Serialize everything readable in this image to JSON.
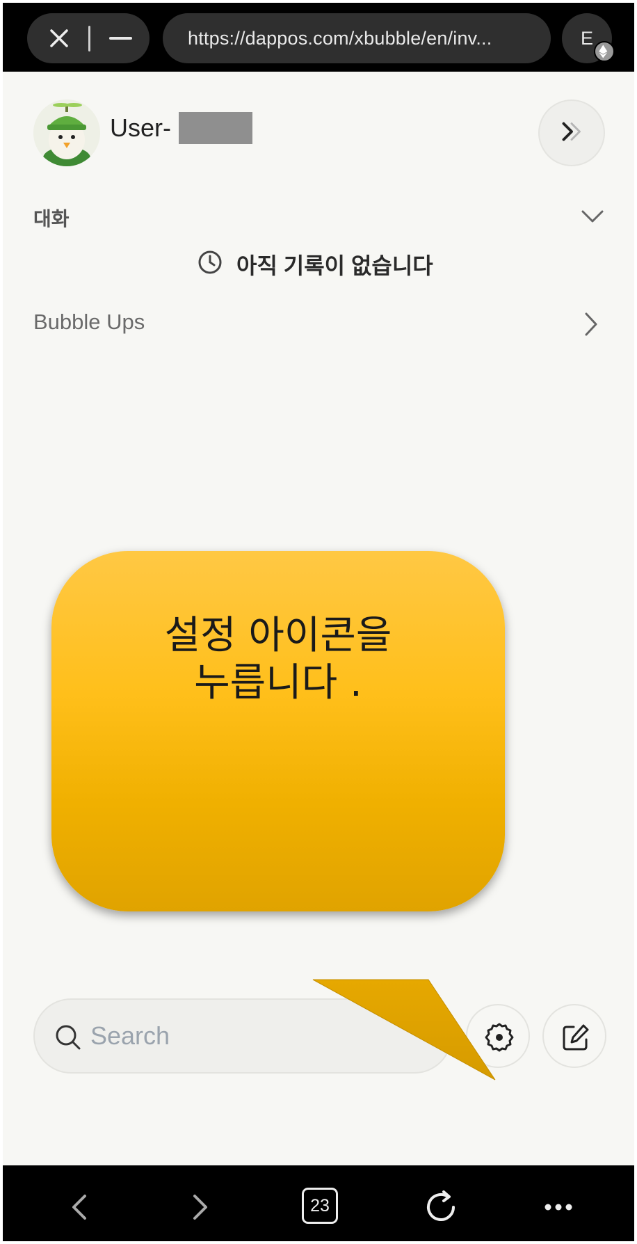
{
  "browser": {
    "url": "https://dappos.com/xbubble/en/inv...",
    "extension_label": "E",
    "tab_count": "23"
  },
  "profile": {
    "username": "User-"
  },
  "sidebar": {
    "section_label": "대화",
    "empty_text": "아직 기록이 없습니다",
    "bubble_ups_label": "Bubble Ups"
  },
  "search": {
    "placeholder": "Search"
  },
  "callout": {
    "line1": "설정 아이콘을",
    "line2": "누릅니다 ."
  },
  "colors": {
    "page_bg": "#f7f7f4",
    "callout_top": "#ffc844",
    "callout_bottom": "#e0a300"
  }
}
